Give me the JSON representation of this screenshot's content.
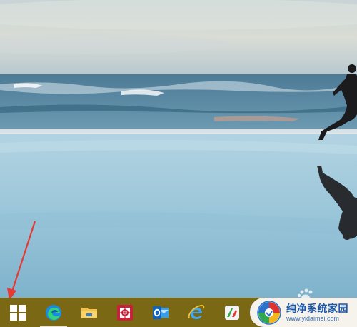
{
  "taskbar": {
    "items": [
      {
        "name": "Start",
        "icon": "windows-logo-icon"
      },
      {
        "name": "Microsoft Edge",
        "icon": "edge-icon"
      },
      {
        "name": "File Explorer",
        "icon": "folder-icon"
      },
      {
        "name": "Screenshot tool",
        "icon": "capture-icon"
      },
      {
        "name": "Outlook",
        "icon": "outlook-icon"
      },
      {
        "name": "Internet Explorer",
        "icon": "ie-icon"
      },
      {
        "name": "App",
        "icon": "app-icon"
      }
    ],
    "active_item": "Microsoft Edge"
  },
  "annotation": {
    "type": "red-arrow",
    "points_to": "Start"
  },
  "watermark": {
    "title": "纯净系统家园",
    "url": "www.yidaimei.com"
  },
  "colors": {
    "taskbar": "#7a6815",
    "arrow": "#e53935",
    "watermark_text": "#1d58a8"
  }
}
